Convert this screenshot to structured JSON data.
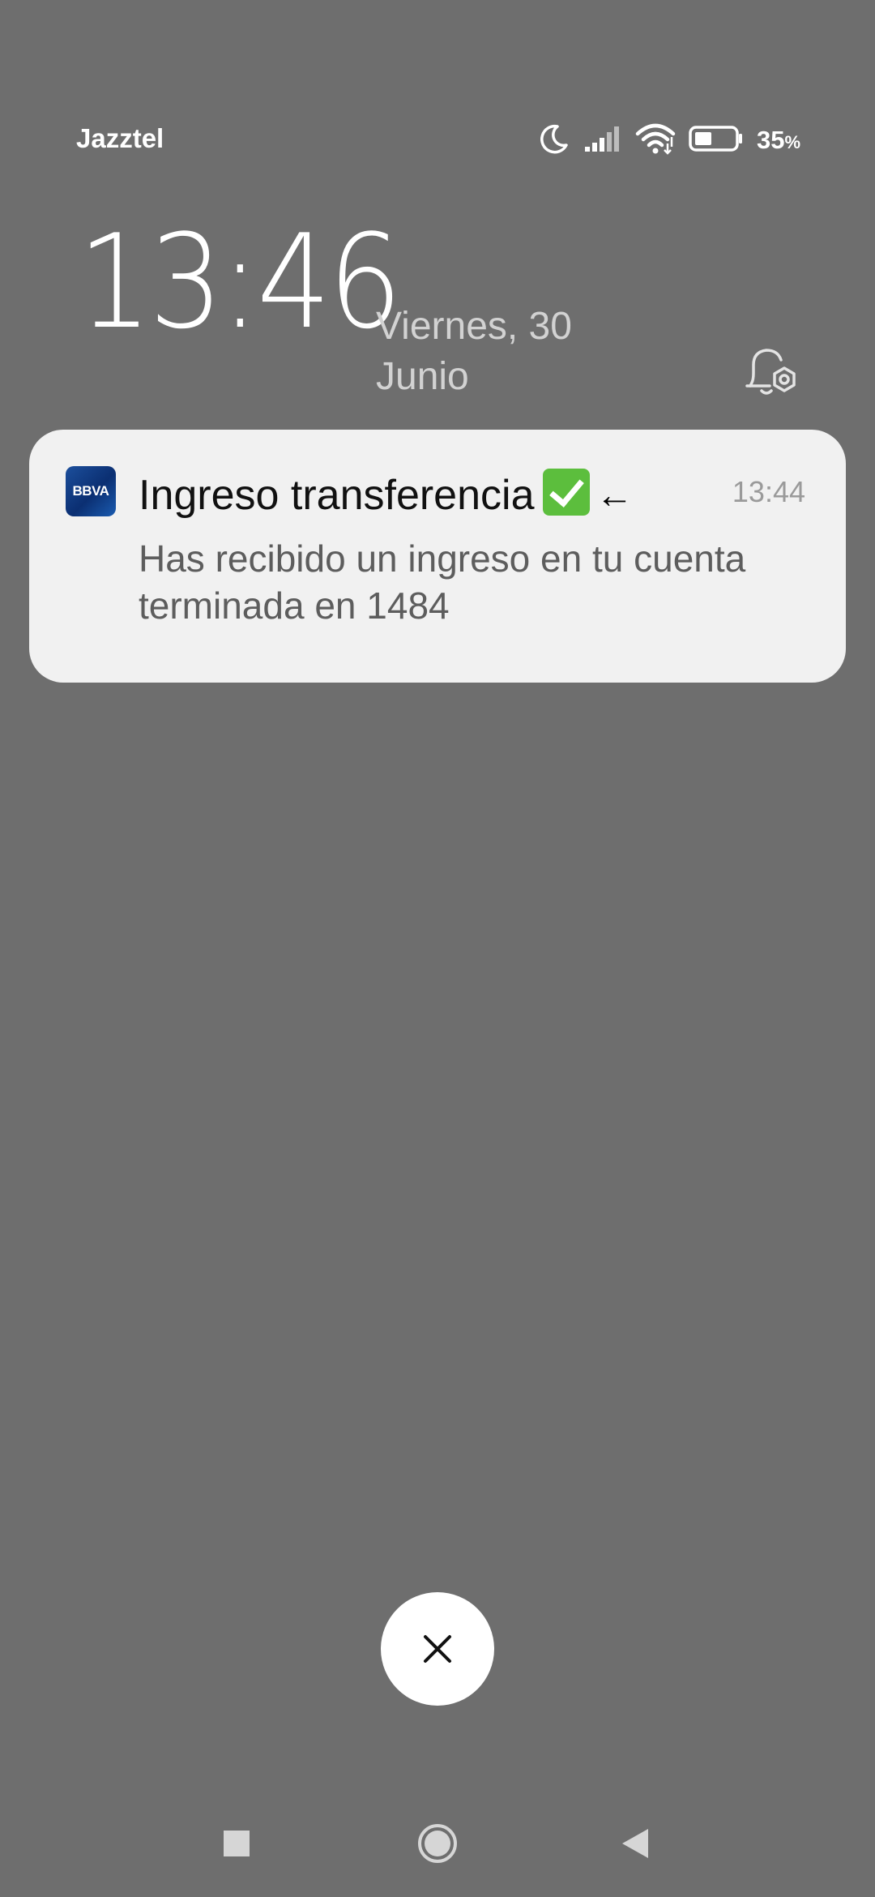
{
  "status_bar": {
    "carrier": "Jazztel",
    "battery_percent": "35",
    "battery_unit": "%",
    "battery_level": 0.35,
    "icons": [
      "moon-icon",
      "signal-icon",
      "wifi-icon",
      "battery-icon"
    ]
  },
  "lockscreen": {
    "time": "13:46",
    "date_line1": "Viernes, 30",
    "date_line2": "Junio"
  },
  "notification": {
    "app_icon_label": "BBVA",
    "title": "Ingreso transferencia",
    "arrow": "←",
    "time": "13:44",
    "body": "Has recibido un ingreso en tu cuenta terminada en 1484"
  },
  "colors": {
    "background": "#6e6e6e",
    "card": "#f1f1f1",
    "bbva_blue": "#0b2f72",
    "check_green": "#5cbe3d"
  }
}
